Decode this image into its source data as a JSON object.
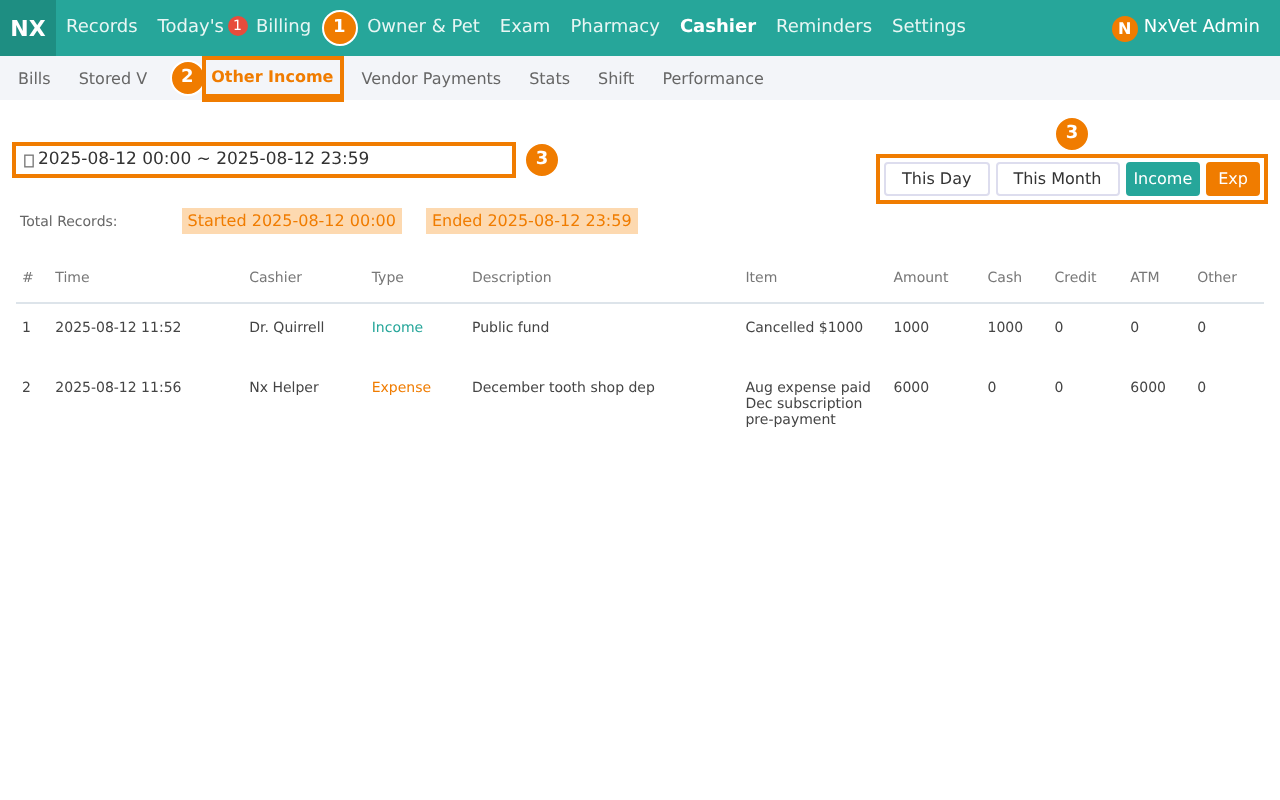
{
  "logo": "NX",
  "nav": [
    {
      "label": "Records",
      "selected": false
    },
    {
      "label": "Today's",
      "selected": false,
      "badge": "1"
    },
    {
      "label": "Billing",
      "selected": false
    },
    {
      "label": "Owner & Pet",
      "selected": false
    },
    {
      "label": "Exam",
      "selected": false
    },
    {
      "label": "Pharmacy",
      "selected": false
    },
    {
      "label": "Cashier",
      "selected": true
    },
    {
      "label": "Reminders",
      "selected": false
    },
    {
      "label": "Settings",
      "selected": false
    }
  ],
  "user": {
    "initial": "N",
    "name": "NxVet Admin"
  },
  "subnav": [
    {
      "label": "Bills",
      "selected": false
    },
    {
      "label": "Stored V",
      "selected": false
    },
    {
      "label": "Other Income",
      "selected": true
    },
    {
      "label": "Vendor Payments",
      "selected": false
    },
    {
      "label": "Stats",
      "selected": false
    },
    {
      "label": "Shift",
      "selected": false
    },
    {
      "label": "Performance",
      "selected": false
    }
  ],
  "date_range": {
    "value": "2025-08-12 00:00 ~ 2025-08-12 23:59"
  },
  "range_buttons": [
    {
      "label": "This Day",
      "kind": "plain"
    },
    {
      "label": "This Month",
      "kind": "plain"
    },
    {
      "label": "Income",
      "kind": "income"
    },
    {
      "label": "Exp",
      "kind": "expense"
    }
  ],
  "summary": {
    "label": "Total Records:",
    "started": "Started 2025-08-12 00:00",
    "ended": "Ended 2025-08-12 23:59"
  },
  "table": {
    "columns": [
      "#",
      "Time",
      "Cashier",
      "Type",
      "Description",
      "Item",
      "Amount",
      "Cash",
      "Credit",
      "ATM",
      "Other"
    ],
    "rows": [
      {
        "cells": [
          "1",
          "2025-08-12 11:52",
          "Dr. Quirrell",
          "Income",
          "Public fund",
          "Cancelled $1000",
          "1000",
          "1000",
          "0",
          "0",
          "0"
        ],
        "color": "#26a69a"
      },
      {
        "cells": [
          "2",
          "2025-08-12 11:56",
          "Nx Helper",
          "Expense",
          "December tooth shop dep",
          "Aug expense paid Dec subscription pre-payment",
          "6000",
          "0",
          "0",
          "6000",
          "0"
        ],
        "color": "#f07c00"
      }
    ]
  },
  "markers": [
    {
      "label": "1"
    },
    {
      "label": "2"
    },
    {
      "label": "3"
    },
    {
      "label": "3"
    }
  ]
}
